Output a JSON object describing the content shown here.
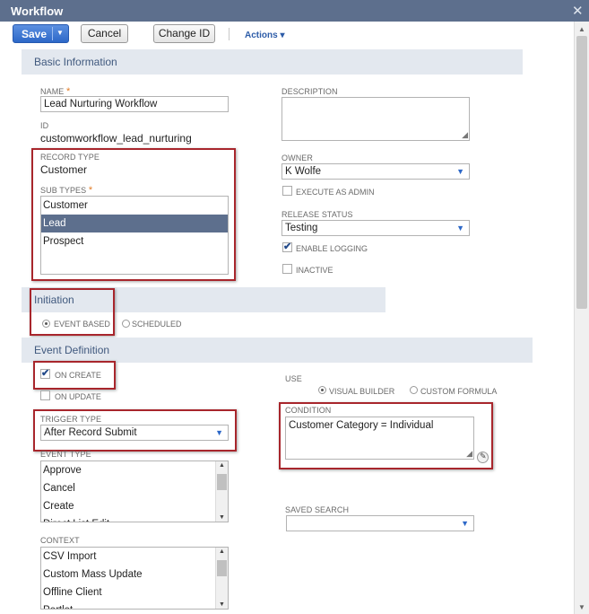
{
  "window": {
    "title": "Workflow",
    "close_glyph": "✕"
  },
  "toolbar": {
    "save_label": "Save",
    "cancel_label": "Cancel",
    "change_id_label": "Change ID",
    "actions_label": "Actions ▾"
  },
  "basic": {
    "section_title": "Basic Information",
    "name_label": "NAME",
    "name_value": "Lead Nurturing Workflow",
    "id_label": "ID",
    "id_value": "customworkflow_lead_nurturing",
    "record_type_label": "RECORD TYPE",
    "record_type_value": "Customer",
    "sub_types_label": "SUB TYPES",
    "sub_types": [
      "Customer",
      "Lead",
      "Prospect"
    ],
    "sub_types_selected": "Lead",
    "description_label": "DESCRIPTION",
    "owner_label": "OWNER",
    "owner_value": "K Wolfe",
    "execute_as_admin_label": "EXECUTE AS ADMIN",
    "release_status_label": "RELEASE STATUS",
    "release_status_value": "Testing",
    "enable_logging_label": "ENABLE LOGGING",
    "inactive_label": "INACTIVE"
  },
  "initiation": {
    "section_title": "Initiation",
    "event_based_label": "EVENT BASED",
    "scheduled_label": "SCHEDULED",
    "selected": "EVENT BASED"
  },
  "event_def": {
    "section_title": "Event Definition",
    "on_create_label": "ON CREATE",
    "on_update_label": "ON UPDATE",
    "trigger_type_label": "TRIGGER TYPE",
    "trigger_type_value": "After Record Submit",
    "event_type_label": "EVENT TYPE",
    "event_types": [
      "Approve",
      "Cancel",
      "Create",
      "Direct List Edit"
    ],
    "context_label": "CONTEXT",
    "contexts": [
      "CSV Import",
      "Custom Mass Update",
      "Offline Client",
      "Portlet"
    ],
    "use_label": "USE",
    "visual_builder_label": "VISUAL BUILDER",
    "custom_formula_label": "CUSTOM FORMULA",
    "use_selected": "VISUAL BUILDER",
    "condition_label": "CONDITION",
    "condition_value": "Customer Category = Individual",
    "saved_search_label": "SAVED SEARCH",
    "saved_search_value": ""
  },
  "colors": {
    "titlebar": "#5d6f8d",
    "save_button": "#2d68c8",
    "section_header": "#e3e8ef",
    "highlight_border": "#a8262c",
    "selected_option": "#5d6f8d"
  }
}
